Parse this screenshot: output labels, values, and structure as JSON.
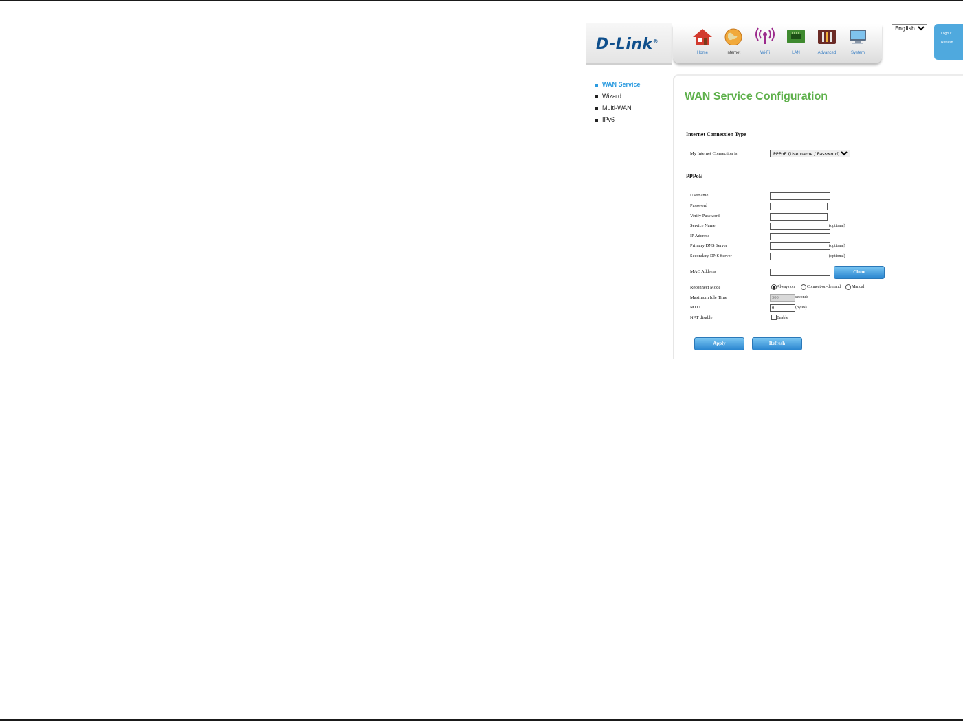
{
  "header": {
    "logo": "D-Link",
    "nav": [
      {
        "label": "Home",
        "icon": "home-icon"
      },
      {
        "label": "Internet",
        "icon": "globe-icon"
      },
      {
        "label": "Wi-Fi",
        "icon": "wifi-icon"
      },
      {
        "label": "LAN",
        "icon": "lan-icon"
      },
      {
        "label": "Advanced",
        "icon": "tools-icon"
      },
      {
        "label": "System",
        "icon": "monitor-icon"
      }
    ],
    "active_nav": "Internet",
    "language": "English",
    "side_links": [
      "Logout",
      "Refresh"
    ]
  },
  "menu": {
    "items": [
      "WAN Service",
      "Wizard",
      "Multi-WAN",
      "IPv6"
    ],
    "active": "WAN Service"
  },
  "main": {
    "title": "WAN Service Configuration",
    "section_connection": "Internet Connection Type",
    "connection_label": "My Internet Connection is",
    "connection_value": "PPPoE (Username / Password)",
    "section_pppoe": "PPPoE",
    "fields": {
      "username": {
        "label": "Username",
        "value": ""
      },
      "password": {
        "label": "Password",
        "value": ""
      },
      "verify_password": {
        "label": "Verify Password",
        "value": ""
      },
      "service_name": {
        "label": "Service Name",
        "value": "",
        "note": "(optional)"
      },
      "ip_address": {
        "label": "IP Address",
        "value": ""
      },
      "primary_dns": {
        "label": "Primary DNS Server",
        "value": "",
        "note": "(optional)"
      },
      "secondary_dns": {
        "label": "Secondary DNS Server",
        "value": "",
        "note": "(optional)"
      },
      "mac_address": {
        "label": "MAC Address",
        "value": "",
        "button": "Clone"
      },
      "reconnect_mode": {
        "label": "Reconnect Mode",
        "options": [
          "Always on",
          "Connect-on-demand",
          "Manual"
        ],
        "selected": "Always on"
      },
      "max_idle": {
        "label": "Maximum Idle Time",
        "value": "300",
        "unit": "seconds"
      },
      "mtu": {
        "label": "MTU",
        "value": "0",
        "unit": "(bytes)"
      },
      "nat_disable": {
        "label": "NAT disable",
        "checkbox": "Enable",
        "checked": false
      }
    },
    "apply_label": "Apply",
    "refresh_label": "Refresh"
  },
  "colors": {
    "title_green": "#5db04a",
    "accent_blue": "#2b9be0",
    "button_blue": "#2b86d0",
    "logo_blue": "#0f4f8c"
  }
}
